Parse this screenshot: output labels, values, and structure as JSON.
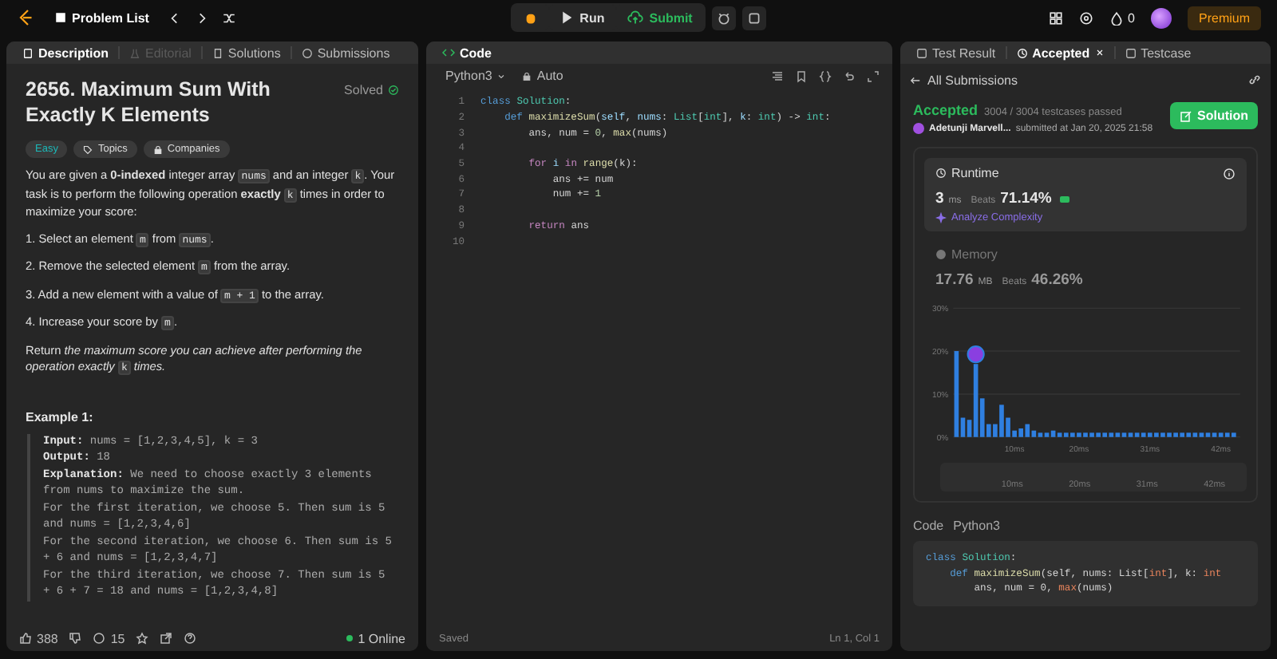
{
  "topbar": {
    "problem_list": "Problem List",
    "run": "Run",
    "submit": "Submit",
    "streak": "0",
    "premium": "Premium"
  },
  "description": {
    "tabs": [
      {
        "label": "Description",
        "selected": true,
        "disabled": false
      },
      {
        "label": "Editorial",
        "selected": false,
        "disabled": true
      },
      {
        "label": "Solutions",
        "selected": false,
        "disabled": false
      },
      {
        "label": "Submissions",
        "selected": false,
        "disabled": false
      }
    ],
    "title": "2656. Maximum Sum With Exactly K Elements",
    "status": "Solved",
    "tags": [
      {
        "label": "Easy",
        "kind": "difficulty"
      },
      {
        "label": "Topics",
        "kind": "topics"
      },
      {
        "label": "Companies",
        "kind": "companies"
      }
    ],
    "paragraphs": [
      [
        {
          "text": "You are given a ",
          "kind": "text"
        },
        {
          "text": "0-indexed",
          "kind": "bold"
        },
        {
          "text": " integer array ",
          "kind": "text"
        },
        {
          "text": "nums",
          "kind": "code"
        },
        {
          "text": " and an integer ",
          "kind": "text"
        },
        {
          "text": "k",
          "kind": "code"
        },
        {
          "text": ". Your task is to perform the following operation ",
          "kind": "text"
        },
        {
          "text": "exactly ",
          "kind": "bold"
        },
        {
          "text": "k",
          "kind": "code"
        },
        {
          "text": " times in order to maximize your score:",
          "kind": "text"
        }
      ],
      [
        {
          "text": "1. Select an element ",
          "kind": "text"
        },
        {
          "text": "m",
          "kind": "code"
        },
        {
          "text": " from ",
          "kind": "text"
        },
        {
          "text": "nums",
          "kind": "code"
        },
        {
          "text": ".",
          "kind": "text"
        }
      ],
      [
        {
          "text": "2. Remove the selected element ",
          "kind": "text"
        },
        {
          "text": "m",
          "kind": "code"
        },
        {
          "text": " from the array.",
          "kind": "text"
        }
      ],
      [
        {
          "text": "3. Add a new element with a value of ",
          "kind": "text"
        },
        {
          "text": "m + 1",
          "kind": "code"
        },
        {
          "text": " to the array.",
          "kind": "text"
        }
      ],
      [
        {
          "text": "4. Increase your score by ",
          "kind": "text"
        },
        {
          "text": "m",
          "kind": "code"
        },
        {
          "text": ".",
          "kind": "text"
        }
      ],
      [
        {
          "text": "Return ",
          "kind": "text"
        },
        {
          "text": "the maximum score you can achieve after performing the operation exactly ",
          "kind": "italic"
        },
        {
          "text": "k",
          "kind": "code"
        },
        {
          "text": " times.",
          "kind": "italic"
        }
      ]
    ],
    "example": {
      "heading": "Example 1:",
      "lines": [
        {
          "label": "Input:",
          "text": " nums = [1,2,3,4,5], k = 3"
        },
        {
          "label": "Output:",
          "text": " 18"
        },
        {
          "label": "Explanation:",
          "text": " We need to choose exactly 3 elements"
        },
        {
          "text": "from nums to maximize the sum."
        },
        {
          "text": "For the first iteration, we choose 5. Then sum is 5"
        },
        {
          "text": "and nums = [1,2,3,4,6]"
        },
        {
          "text": "For the second iteration, we choose 6. Then sum is 5"
        },
        {
          "text": "+ 6 and nums = [1,2,3,4,7]"
        },
        {
          "text": "For the third iteration, we choose 7. Then sum is 5"
        },
        {
          "text": "+ 6 + 7 = 18 and nums = [1,2,3,4,8]"
        }
      ]
    },
    "footer": {
      "likes": "388",
      "comments": "15",
      "online": "1 Online"
    }
  },
  "code": {
    "title": "Code",
    "language": "Python3",
    "mode": "Auto",
    "status": "Saved",
    "cursor": "Ln 1, Col 1",
    "lines": [
      {
        "number": "1",
        "tokens": [
          {
            "text": "class ",
            "kind": "keyword"
          },
          {
            "text": "Solution",
            "kind": "type"
          },
          {
            "text": ":",
            "kind": "plain"
          }
        ]
      },
      {
        "number": "2",
        "tokens": [
          {
            "text": "    def ",
            "kind": "keyword"
          },
          {
            "text": "maximizeSum",
            "kind": "function"
          },
          {
            "text": "(",
            "kind": "plain"
          },
          {
            "text": "self",
            "kind": "param"
          },
          {
            "text": ", ",
            "kind": "plain"
          },
          {
            "text": "nums",
            "kind": "param"
          },
          {
            "text": ": ",
            "kind": "plain"
          },
          {
            "text": "List",
            "kind": "type"
          },
          {
            "text": "[",
            "kind": "plain"
          },
          {
            "text": "int",
            "kind": "type"
          },
          {
            "text": "], ",
            "kind": "plain"
          },
          {
            "text": "k",
            "kind": "param"
          },
          {
            "text": ": ",
            "kind": "plain"
          },
          {
            "text": "int",
            "kind": "type"
          },
          {
            "text": ") -> ",
            "kind": "plain"
          },
          {
            "text": "int",
            "kind": "type"
          },
          {
            "text": ":",
            "kind": "plain"
          }
        ]
      },
      {
        "number": "3",
        "tokens": [
          {
            "text": "        ans, num = ",
            "kind": "plain"
          },
          {
            "text": "0",
            "kind": "number"
          },
          {
            "text": ", ",
            "kind": "plain"
          },
          {
            "text": "max",
            "kind": "function"
          },
          {
            "text": "(nums)",
            "kind": "plain"
          }
        ]
      },
      {
        "number": "4"
      },
      {
        "number": "5",
        "tokens": [
          {
            "text": "        for ",
            "kind": "control"
          },
          {
            "text": "i ",
            "kind": "param"
          },
          {
            "text": "in ",
            "kind": "control"
          },
          {
            "text": "range",
            "kind": "function"
          },
          {
            "text": "(k):",
            "kind": "plain"
          }
        ]
      },
      {
        "number": "6",
        "tokens": [
          {
            "text": "            ans += num",
            "kind": "plain"
          }
        ]
      },
      {
        "number": "7",
        "tokens": [
          {
            "text": "            num += ",
            "kind": "plain"
          },
          {
            "text": "1",
            "kind": "number"
          }
        ]
      },
      {
        "number": "8"
      },
      {
        "number": "9",
        "tokens": [
          {
            "text": "        return ",
            "kind": "control"
          },
          {
            "text": "ans",
            "kind": "plain"
          }
        ]
      },
      {
        "number": "10"
      }
    ]
  },
  "result": {
    "tabs": [
      {
        "label": "Test Result",
        "selected": false,
        "closable": false
      },
      {
        "label": "Accepted",
        "selected": true,
        "closable": true
      },
      {
        "label": "Testcase",
        "selected": false,
        "closable": false
      }
    ],
    "back": "All Submissions",
    "verdict": "Accepted",
    "passed": "3004 / 3004 testcases passed",
    "user": "Adetunji Marvell...",
    "submitted": "submitted at Jan 20, 2025 21:58",
    "solution_button": "Solution",
    "runtime": {
      "label": "Runtime",
      "value": "3",
      "unit": "ms",
      "beats_label": "Beats",
      "beats": "71.14%",
      "analyze": "Analyze Complexity"
    },
    "memory": {
      "label": "Memory",
      "value": "17.76",
      "unit": "MB",
      "beats_label": "Beats",
      "beats": "46.26%"
    },
    "chart_data": {
      "type": "bar",
      "x": [
        1,
        2,
        3,
        4,
        5,
        6,
        7,
        8,
        9,
        10,
        11,
        12,
        13,
        14,
        15,
        16,
        17,
        18,
        19,
        20,
        21,
        22,
        23,
        24,
        25,
        26,
        27,
        28,
        29,
        30,
        31,
        32,
        33,
        34,
        35,
        36,
        37,
        38,
        39,
        40,
        41,
        42,
        43,
        44
      ],
      "values": [
        20,
        4.5,
        4,
        17,
        9,
        3,
        3,
        7.5,
        4.5,
        1.5,
        2,
        3,
        1.5,
        1,
        1,
        1.5,
        1,
        1,
        1,
        1,
        1,
        1,
        1,
        1,
        1,
        1,
        1,
        1,
        1,
        1,
        1,
        1,
        1,
        1,
        1,
        1,
        1,
        1,
        1,
        1,
        1,
        1,
        1,
        1
      ],
      "xlim": [
        0.5,
        44.5
      ],
      "ylim": [
        0,
        30
      ],
      "yticks": [
        {
          "value": 0,
          "label": "0%"
        },
        {
          "value": 10,
          "label": "10%"
        },
        {
          "value": 20,
          "label": "20%"
        },
        {
          "value": 30,
          "label": "30%"
        }
      ],
      "xticks": [
        {
          "value": 10,
          "label": "10ms"
        },
        {
          "value": 20,
          "label": "20ms"
        },
        {
          "value": 31,
          "label": "31ms"
        },
        {
          "value": 42,
          "label": "42ms"
        }
      ]
    },
    "overview_ticks": [
      "10ms",
      "20ms",
      "31ms",
      "42ms"
    ],
    "code_label": "Code",
    "code_language": "Python3",
    "code_lines": [
      [
        {
          "text": "class ",
          "kind": "keyword"
        },
        {
          "text": "Solution",
          "kind": "type"
        },
        {
          "text": ":",
          "kind": "plain"
        }
      ],
      [
        {
          "text": "    def ",
          "kind": "keyword"
        },
        {
          "text": "maximizeSum",
          "kind": "function"
        },
        {
          "text": "(self, nums: List[",
          "kind": "plain"
        },
        {
          "text": "int",
          "kind": "builtin"
        },
        {
          "text": "], k: ",
          "kind": "plain"
        },
        {
          "text": "int",
          "kind": "builtin"
        }
      ],
      [
        {
          "text": "        ans, num = 0, ",
          "kind": "plain"
        },
        {
          "text": "max",
          "kind": "builtin"
        },
        {
          "text": "(nums)",
          "kind": "plain"
        }
      ]
    ]
  }
}
